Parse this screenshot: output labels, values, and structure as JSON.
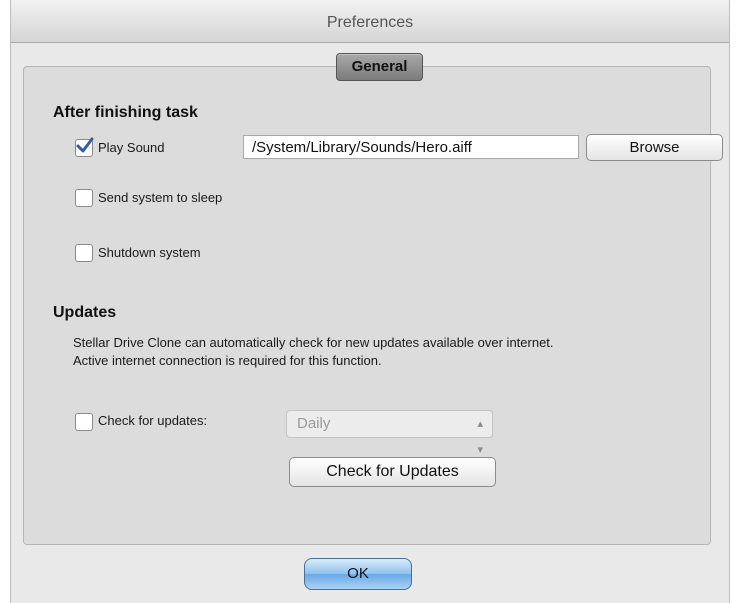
{
  "window": {
    "title": "Preferences",
    "tab_label": "General"
  },
  "after_task": {
    "heading": "After finishing task",
    "play_sound": {
      "label": "Play Sound",
      "checked": true
    },
    "sound_path": "/System/Library/Sounds/Hero.aiff",
    "browse_label": "Browse",
    "send_sleep": {
      "label": "Send system to sleep",
      "checked": false
    },
    "shutdown": {
      "label": "Shutdown system",
      "checked": false
    }
  },
  "updates": {
    "heading": "Updates",
    "description_line1": "Stellar Drive Clone can automatically check for new updates available over internet.",
    "description_line2": "Active internet connection is required for this function.",
    "check_for_updates": {
      "label": "Check for updates:",
      "checked": false
    },
    "frequency_selected": "Daily",
    "check_button_label": "Check for Updates"
  },
  "footer": {
    "ok_label": "OK"
  },
  "icons": {
    "checkmark": "checkmark-icon",
    "select_arrows": "updown-arrows-icon"
  },
  "colors": {
    "ok_button_blue": "#8fc1ee",
    "tab_gray": "#8a8a8a",
    "checkmark_blue": "#2f5fa8"
  }
}
